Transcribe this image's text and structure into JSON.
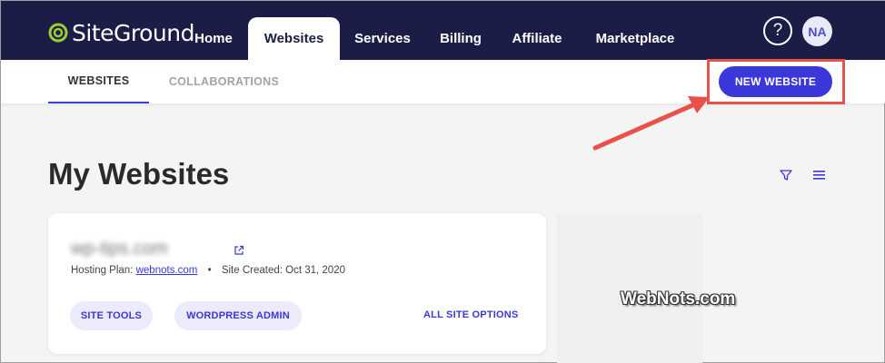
{
  "header": {
    "logo_text": "SiteGround",
    "nav": [
      "Home",
      "Websites",
      "Services",
      "Billing",
      "Affiliate",
      "Marketplace"
    ],
    "active_nav": "Websites",
    "help_icon": "question-mark-icon",
    "avatar_initials": "NA"
  },
  "subnav": {
    "tabs": [
      "WEBSITES",
      "COLLABORATIONS"
    ],
    "active_tab": "WEBSITES",
    "new_website_label": "NEW WEBSITE"
  },
  "main": {
    "title": "My Websites",
    "site": {
      "domain": "wp-tips.com",
      "hosting_plan_label": "Hosting Plan:",
      "hosting_plan": "webnots.com",
      "created_label": "Site Created:",
      "created_date": "Oct 31, 2020",
      "buttons": {
        "site_tools": "SITE TOOLS",
        "wordpress_admin": "WORDPRESS ADMIN",
        "all_site_options": "ALL SITE OPTIONS"
      }
    }
  },
  "watermark": "WebNots.com",
  "colors": {
    "nav_bg": "#1b1d46",
    "accent": "#3b37d9",
    "highlight": "#e8524a"
  }
}
